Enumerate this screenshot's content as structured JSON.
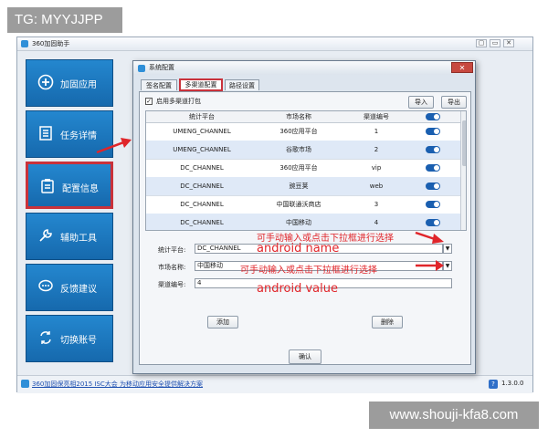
{
  "tag": "TG: MYYJJPP",
  "watermark": "www.shouji-kfa8.com",
  "app": {
    "title": "360加固助手",
    "win_controls": [
      "▢",
      "▭",
      "✕"
    ],
    "sidebar": [
      {
        "label": "加固应用",
        "icon": "plus-circle-icon"
      },
      {
        "label": "任务详情",
        "icon": "document-list-icon"
      },
      {
        "label": "配置信息",
        "icon": "config-clipboard-icon"
      },
      {
        "label": "辅助工具",
        "icon": "wrench-icon"
      },
      {
        "label": "反馈建议",
        "icon": "chat-bubble-icon"
      },
      {
        "label": "切换账号",
        "icon": "switch-account-icon"
      }
    ],
    "footer": {
      "news": "360加固保亮相2015 ISC大会 为移动应用安全提供解决方案",
      "help": "?",
      "version": "1.3.0.0"
    }
  },
  "dialog": {
    "title": "系统配置",
    "close": "✕",
    "tabs": [
      "签名配置",
      "多渠道配置",
      "路径设置"
    ],
    "checkbox_label": "启用多渠道打包",
    "checkbox_mark": "✓",
    "import_label": "导入",
    "export_label": "导出",
    "table": {
      "headers": [
        "统计平台",
        "市场名称",
        "渠道编号"
      ],
      "rows": [
        [
          "UMENG_CHANNEL",
          "360应用平台",
          "1"
        ],
        [
          "UMENG_CHANNEL",
          "谷歌市场",
          "2"
        ],
        [
          "DC_CHANNEL",
          "360应用平台",
          "vip"
        ],
        [
          "DC_CHANNEL",
          "豌豆荚",
          "web"
        ],
        [
          "DC_CHANNEL",
          "中国联通沃商店",
          "3"
        ],
        [
          "DC_CHANNEL",
          "中国移动",
          "4"
        ]
      ]
    },
    "form": {
      "platform_label": "统计平台:",
      "platform_value": "DC_CHANNEL",
      "market_label": "市场名称:",
      "market_value": "中国移动",
      "channel_label": "渠道编号:",
      "channel_value": "4"
    },
    "add_label": "添加",
    "delete_label": "删除",
    "confirm_label": "确认",
    "annotations": {
      "name_hint": "android name",
      "manual_hint": "可手动输入或点击下拉框进行选择",
      "value_hint": "android value"
    }
  }
}
